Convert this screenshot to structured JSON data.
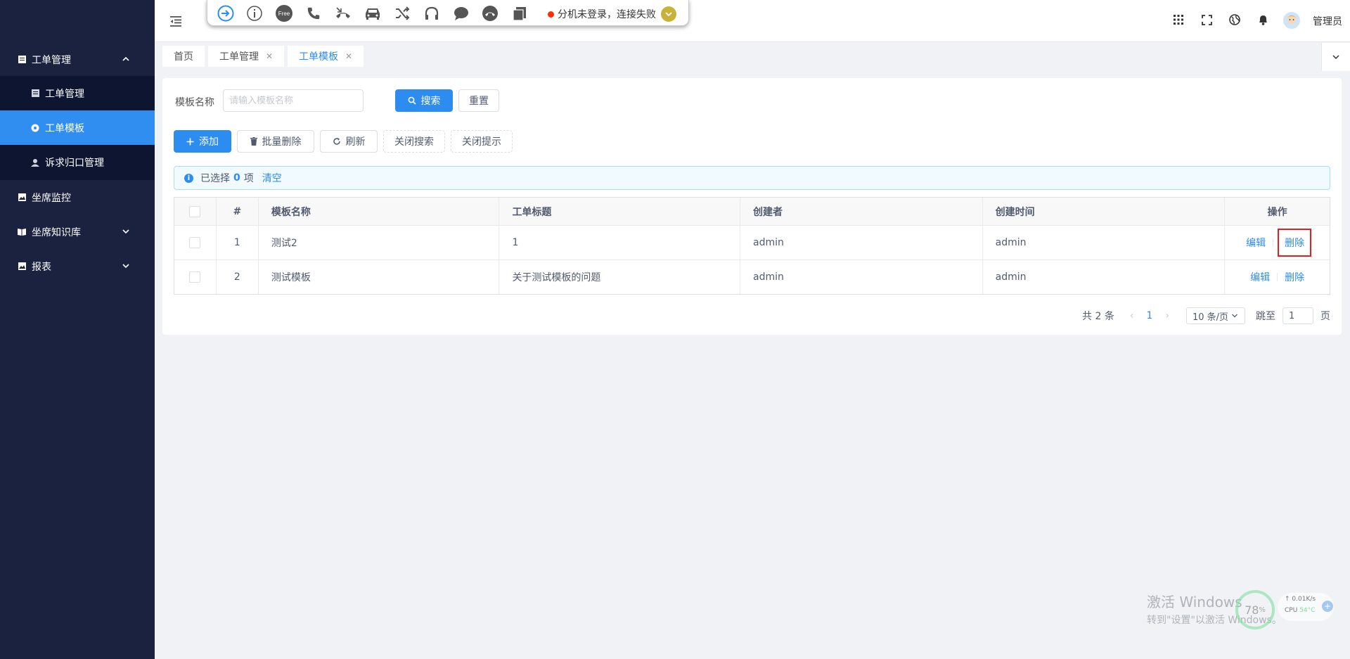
{
  "sidebar": {
    "items": [
      {
        "label": "工单管理",
        "icon": "list-icon"
      },
      {
        "label": "工单管理",
        "icon": "list-icon"
      },
      {
        "label": "工单模板",
        "icon": "settings-icon"
      },
      {
        "label": "诉求归口管理",
        "icon": "people-icon"
      },
      {
        "label": "坐席监控",
        "icon": "image-icon"
      },
      {
        "label": "坐席知识库",
        "icon": "book-icon"
      },
      {
        "label": "报表",
        "icon": "image-icon"
      }
    ]
  },
  "phonebar": {
    "free_label": "Free",
    "status_text": "分机未登录，连接失败"
  },
  "header": {
    "username": "管理员"
  },
  "tags": [
    {
      "label": "首页"
    },
    {
      "label": "工单管理"
    },
    {
      "label": "工单模板"
    }
  ],
  "search": {
    "label": "模板名称",
    "placeholder": "请输入模板名称",
    "search_btn": "搜索",
    "reset_btn": "重置"
  },
  "toolbar": {
    "add": "添加",
    "batch_delete": "批量删除",
    "refresh": "刷新",
    "close_search": "关闭搜索",
    "close_tip": "关闭提示"
  },
  "alert": {
    "prefix": "已选择",
    "count": "0",
    "suffix": "项",
    "clear": "清空"
  },
  "table": {
    "headers": [
      "#",
      "模板名称",
      "工单标题",
      "创建者",
      "创建时间",
      "操作"
    ],
    "rows": [
      {
        "index": "1",
        "name": "测试2",
        "title": "1",
        "creator": "admin",
        "created": "admin",
        "edit": "编辑",
        "delete": "删除"
      },
      {
        "index": "2",
        "name": "测试模板",
        "title": "关于测试模板的问题",
        "creator": "admin",
        "created": "admin",
        "edit": "编辑",
        "delete": "删除"
      }
    ]
  },
  "pagination": {
    "total": "共 2 条",
    "current": "1",
    "page_size": "10 条/页",
    "jump_label": "跳至",
    "jump_value": "1",
    "page_unit": "页"
  },
  "watermark": {
    "line1": "激活 Windows",
    "line2": "转到\"设置\"以激活 Windows。"
  },
  "widget": {
    "percent": "78",
    "percent_unit": "%",
    "speed": "0.01K/s",
    "cpu_label": "CPU",
    "cpu_temp": "54°C"
  },
  "colors": {
    "sidebar_bg": "#1a2240",
    "active": "#2f8ef0",
    "primary": "#2d8cf0",
    "highlight_box": "#e02020"
  }
}
